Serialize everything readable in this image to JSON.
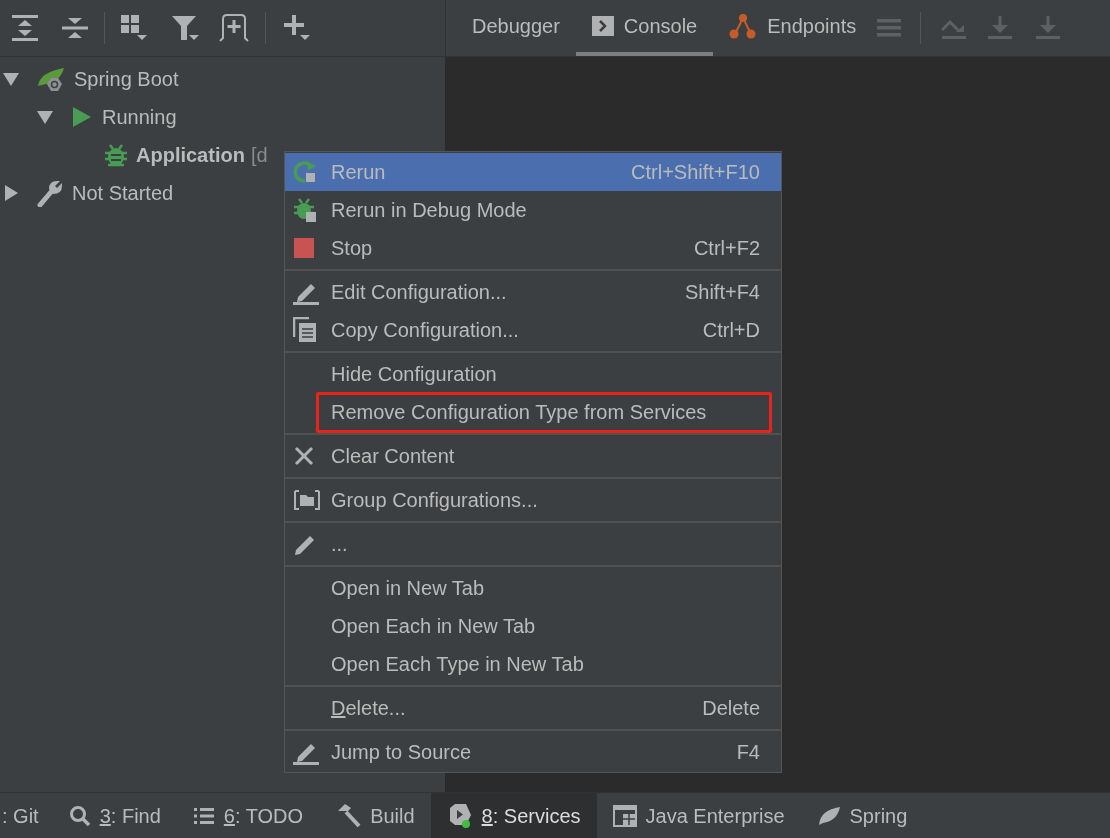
{
  "toolbar": {
    "tabs": [
      {
        "label": "Debugger",
        "selected": false
      },
      {
        "label": "Console",
        "selected": true
      },
      {
        "label": "Endpoints",
        "selected": false
      }
    ]
  },
  "tree": [
    {
      "label": "Spring Boot",
      "expanded": true,
      "selected": false,
      "children": [
        {
          "label": "Running",
          "expanded": true,
          "selected": false,
          "children": [
            {
              "label": "Application",
              "detail": "[d",
              "selected": false,
              "bold": true,
              "kind": "debug"
            }
          ],
          "kind": "running"
        }
      ],
      "kind": "springboot"
    },
    {
      "label": "Not Started",
      "expanded": false,
      "selected": false,
      "kind": "wrench"
    }
  ],
  "context_menu": {
    "groups": [
      [
        {
          "label": "Rerun",
          "shortcut": "Ctrl+Shift+F10",
          "selected": true
        },
        {
          "label": "Rerun in Debug Mode",
          "selected": false
        },
        {
          "label": "Stop",
          "shortcut": "Ctrl+F2",
          "selected": false
        }
      ],
      [
        {
          "label": "Edit Configuration...",
          "shortcut": "Shift+F4",
          "selected": false
        },
        {
          "label": "Copy Configuration...",
          "shortcut": "Ctrl+D",
          "selected": false
        }
      ],
      [
        {
          "label": "Hide Configuration",
          "selected": false
        },
        {
          "label": "Remove Configuration Type from Services",
          "selected": false,
          "annotated": true
        }
      ],
      [
        {
          "label": "Clear Content",
          "selected": false
        }
      ],
      [
        {
          "label": "Group Configurations...",
          "selected": false
        }
      ],
      [
        {
          "label": "...",
          "selected": false
        }
      ],
      [
        {
          "label": "Open in New Tab",
          "selected": false
        },
        {
          "label": "Open Each in New Tab",
          "selected": false
        },
        {
          "label": "Open Each Type in New Tab",
          "selected": false
        }
      ],
      [
        {
          "mnemonic": "D",
          "label": "elete...",
          "shortcut": "Delete",
          "selected": false
        }
      ],
      [
        {
          "label": "Jump to Source",
          "shortcut": "F4",
          "selected": false
        }
      ]
    ]
  },
  "bottom_bar": [
    {
      "label": ": Git",
      "selected": false
    },
    {
      "mnemonic": "3",
      "label": ": Find",
      "selected": false
    },
    {
      "mnemonic": "6",
      "label": ": TODO",
      "selected": false
    },
    {
      "label": "Build",
      "selected": false
    },
    {
      "mnemonic": "8",
      "label": ": Services",
      "selected": true
    },
    {
      "label": "Java Enterprise",
      "selected": false
    },
    {
      "label": "Spring",
      "selected": false
    }
  ]
}
